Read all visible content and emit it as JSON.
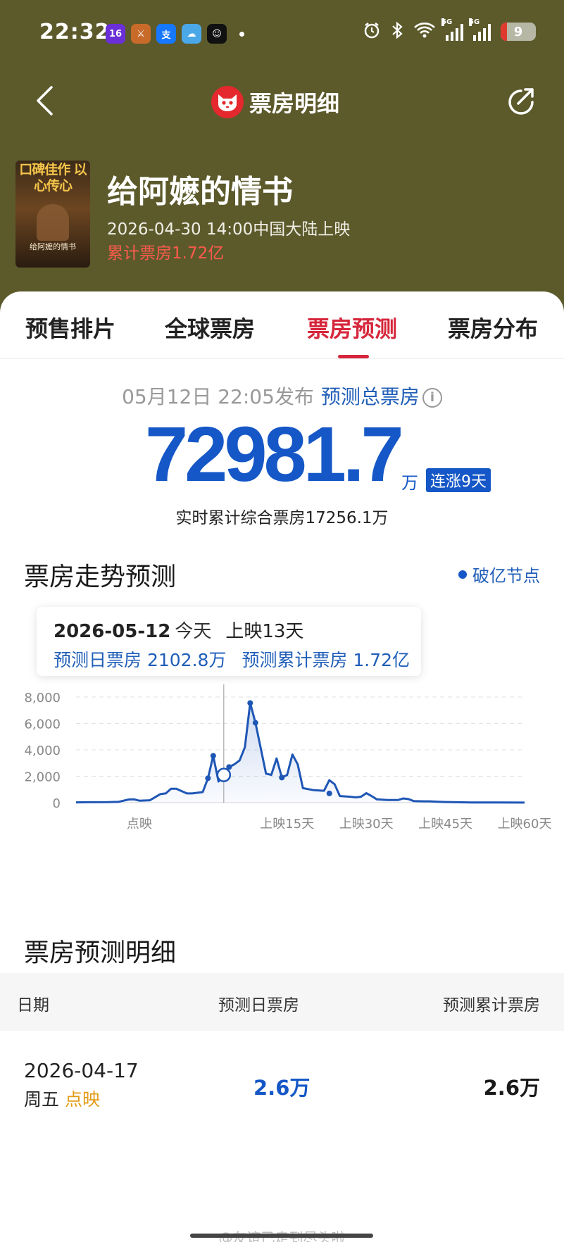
{
  "status_bar": {
    "time": "22:32",
    "battery": "9",
    "signal_1": "5G",
    "signal_2": "5G"
  },
  "nav": {
    "title": "票房明细"
  },
  "movie": {
    "poster_text": "口碑佳作 以心传心",
    "poster_name": "给阿嬷的情书",
    "title": "给阿嬷的情书",
    "release": "2026-04-30 14:00中国大陆上映",
    "gross": "累计票房1.72亿"
  },
  "tabs": [
    "预售排片",
    "全球票房",
    "票房预测",
    "票房分布"
  ],
  "forecast": {
    "published": "05月12日 22:05发布",
    "label": "预测总票房",
    "total": "72981.7",
    "unit": "万",
    "badge": "连涨9天",
    "realtime": "实时累计综合票房17256.1万"
  },
  "trend": {
    "title": "票房走势预测",
    "legend": "破亿节点",
    "tooltip": {
      "date": "2026-05-12",
      "today": "今天",
      "days": "上映13天",
      "daily": "预测日票房 2102.8万",
      "cumulative": "预测累计票房 1.72亿"
    }
  },
  "chart_data": {
    "type": "area",
    "yticks": [
      "8,000",
      "6,000",
      "4,000",
      "2,000",
      "0"
    ],
    "ylim": [
      0,
      8000
    ],
    "xticks": [
      {
        "day": -13,
        "label": "点映"
      },
      {
        "day": 15,
        "label": "上映15天"
      },
      {
        "day": 30,
        "label": "上映30天"
      },
      {
        "day": 45,
        "label": "上映45天"
      },
      {
        "day": 60,
        "label": "上映60天"
      }
    ],
    "series": [
      {
        "values": [
          [
            -25,
            20
          ],
          [
            -22,
            30
          ],
          [
            -19,
            40
          ],
          [
            -17,
            60
          ],
          [
            -15,
            240
          ],
          [
            -14,
            250
          ],
          [
            -13,
            150
          ],
          [
            -11,
            180
          ],
          [
            -9,
            650
          ],
          [
            -8,
            700
          ],
          [
            -7,
            1050
          ],
          [
            -6,
            1050
          ],
          [
            -4,
            700
          ],
          [
            -3,
            700
          ],
          [
            -1,
            800
          ],
          [
            0,
            1850
          ],
          [
            1,
            3550
          ],
          [
            2,
            1600
          ],
          [
            3,
            2100
          ],
          [
            4,
            2700
          ],
          [
            5,
            2900
          ],
          [
            6,
            3200
          ],
          [
            7,
            4200
          ],
          [
            8,
            7550
          ],
          [
            9,
            6050
          ],
          [
            11,
            2200
          ],
          [
            12,
            2100
          ],
          [
            13,
            3350
          ],
          [
            14,
            1900
          ],
          [
            15,
            2100
          ],
          [
            16,
            3650
          ],
          [
            17,
            2900
          ],
          [
            18,
            1100
          ],
          [
            20,
            950
          ],
          [
            22,
            900
          ],
          [
            23,
            1700
          ],
          [
            24,
            1400
          ],
          [
            25,
            500
          ],
          [
            27,
            450
          ],
          [
            28,
            400
          ],
          [
            29,
            450
          ],
          [
            30,
            720
          ],
          [
            31,
            500
          ],
          [
            32,
            250
          ],
          [
            34,
            200
          ],
          [
            35,
            200
          ],
          [
            36,
            200
          ],
          [
            37,
            320
          ],
          [
            38,
            270
          ],
          [
            39,
            120
          ],
          [
            41,
            100
          ],
          [
            42,
            100
          ],
          [
            43,
            80
          ],
          [
            45,
            50
          ],
          [
            47,
            30
          ],
          [
            50,
            10
          ],
          [
            55,
            10
          ],
          [
            60,
            5
          ]
        ]
      }
    ],
    "marked_points": [
      [
        0,
        1850
      ],
      [
        1,
        3550
      ],
      [
        4,
        2700
      ],
      [
        8,
        7550
      ],
      [
        9,
        6050
      ],
      [
        14,
        1900
      ],
      [
        23,
        700
      ]
    ],
    "current_point": [
      3,
      2100
    ]
  },
  "detail": {
    "title": "票房预测明细",
    "headers": [
      "日期",
      "预测日票房",
      "预测累计票房"
    ],
    "rows": [
      {
        "date": "2026-04-17",
        "weekday": "周五",
        "tag": "点映",
        "daily": "2.6万",
        "cumulative": "2.6万"
      }
    ]
  },
  "watermark": "@友谊已走到尽头啦"
}
